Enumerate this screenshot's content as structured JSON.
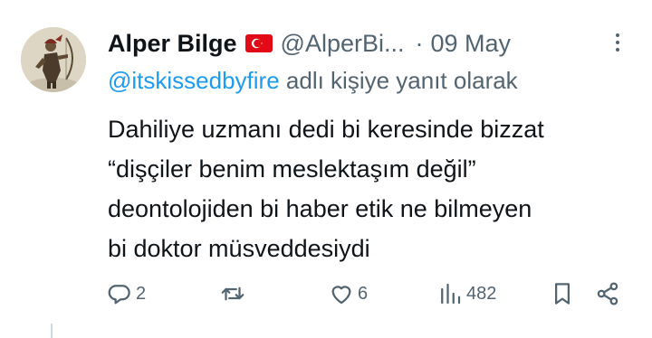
{
  "tweet": {
    "author": {
      "display_name": "Alper Bilge",
      "flag": "turkey-flag",
      "handle": "@AlperBi...",
      "avatar": "warrior-avatar"
    },
    "separator": "·",
    "date": "09 May",
    "reply_context": {
      "mention": "@itskissedbyfire",
      "suffix": " adlı kişiye yanıt olarak"
    },
    "text_lines": [
      "Dahiliye uzmanı dedi bi keresinde bizzat",
      "“dişçiler benim meslektaşım değil”",
      "deontolojiden bi haber etik ne bilmeyen",
      "bi doktor müsveddesiydi"
    ],
    "actions": {
      "reply": {
        "icon": "reply-icon",
        "count": "2"
      },
      "retweet": {
        "icon": "retweet-icon",
        "count": ""
      },
      "like": {
        "icon": "heart-icon",
        "count": "6"
      },
      "views": {
        "icon": "views-icon",
        "count": "482"
      },
      "bookmark": {
        "icon": "bookmark-icon"
      },
      "share": {
        "icon": "share-icon"
      }
    },
    "colors": {
      "text": "#0f1419",
      "secondary": "#536471",
      "link": "#1d9bf0",
      "flag_red": "#e30a17"
    }
  }
}
